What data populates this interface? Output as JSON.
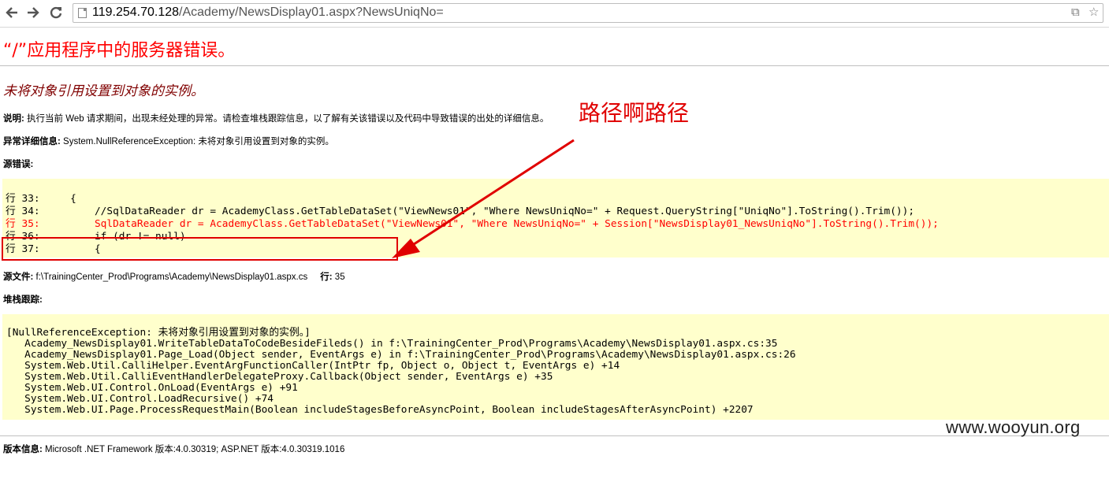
{
  "browser": {
    "url_host": "119.254.70.128",
    "url_path": "/Academy/NewsDisplay01.aspx?NewsUniqNo="
  },
  "page": {
    "title": "“/”应用程序中的服务器错误。",
    "error_message": "未将对象引用设置到对象的实例。",
    "description_label": "说明:",
    "description_text": " 执行当前 Web 请求期间，出现未经处理的异常。请检查堆栈跟踪信息，以了解有关该错误以及代码中导致错误的出处的详细信息。",
    "exception_label": "异常详细信息:",
    "exception_text": " System.NullReferenceException: 未将对象引用设置到对象的实例。",
    "source_error_label": "源错误:",
    "source_lines": [
      {
        "text": "行 33:     {",
        "highlight": false
      },
      {
        "text": "行 34:         //SqlDataReader dr = AcademyClass.GetTableDataSet(\"ViewNews01\", \"Where NewsUniqNo=\" + Request.QueryString[\"UniqNo\"].ToString().Trim());",
        "highlight": false
      },
      {
        "text": "行 35:         SqlDataReader dr = AcademyClass.GetTableDataSet(\"ViewNews01\", \"Where NewsUniqNo=\" + Session[\"NewsDisplay01_NewsUniqNo\"].ToString().Trim());",
        "highlight": true
      },
      {
        "text": "行 36:         if (dr != null)",
        "highlight": false
      },
      {
        "text": "行 37:         {",
        "highlight": false
      }
    ],
    "source_file_label": "源文件:",
    "source_file_path": " f:\\TrainingCenter_Prod\\Programs\\Academy\\NewsDisplay01.aspx.cs",
    "line_label": "行:",
    "line_number": " 35",
    "stack_trace_label": "堆栈跟踪:",
    "stack_lines": [
      "[NullReferenceException: 未将对象引用设置到对象的实例。]",
      "   Academy_NewsDisplay01.WriteTableDataToCodeBesideFileds() in f:\\TrainingCenter_Prod\\Programs\\Academy\\NewsDisplay01.aspx.cs:35",
      "   Academy_NewsDisplay01.Page_Load(Object sender, EventArgs e) in f:\\TrainingCenter_Prod\\Programs\\Academy\\NewsDisplay01.aspx.cs:26",
      "   System.Web.Util.CalliHelper.EventArgFunctionCaller(IntPtr fp, Object o, Object t, EventArgs e) +14",
      "   System.Web.Util.CalliEventHandlerDelegateProxy.Callback(Object sender, EventArgs e) +35",
      "   System.Web.UI.Control.OnLoad(EventArgs e) +91",
      "   System.Web.UI.Control.LoadRecursive() +74",
      "   System.Web.UI.Page.ProcessRequestMain(Boolean includeStagesBeforeAsyncPoint, Boolean includeStagesAfterAsyncPoint) +2207"
    ],
    "version_label": "版本信息:",
    "version_text": " Microsoft .NET Framework 版本:4.0.30319; ASP.NET 版本:4.0.30319.1016"
  },
  "annotation": {
    "text": "路径啊路径",
    "color": "#e00000"
  },
  "watermark": "www.wooyun.org",
  "colors": {
    "title": "#ff0000",
    "error_heading": "#800000",
    "code_background": "#ffffcc",
    "highlight_line": "#ff0000"
  },
  "icons": {
    "back": "back-arrow-icon",
    "forward": "forward-arrow-icon",
    "reload": "reload-icon",
    "page": "page-icon",
    "translate": "translate-icon",
    "bookmark": "star-icon"
  }
}
